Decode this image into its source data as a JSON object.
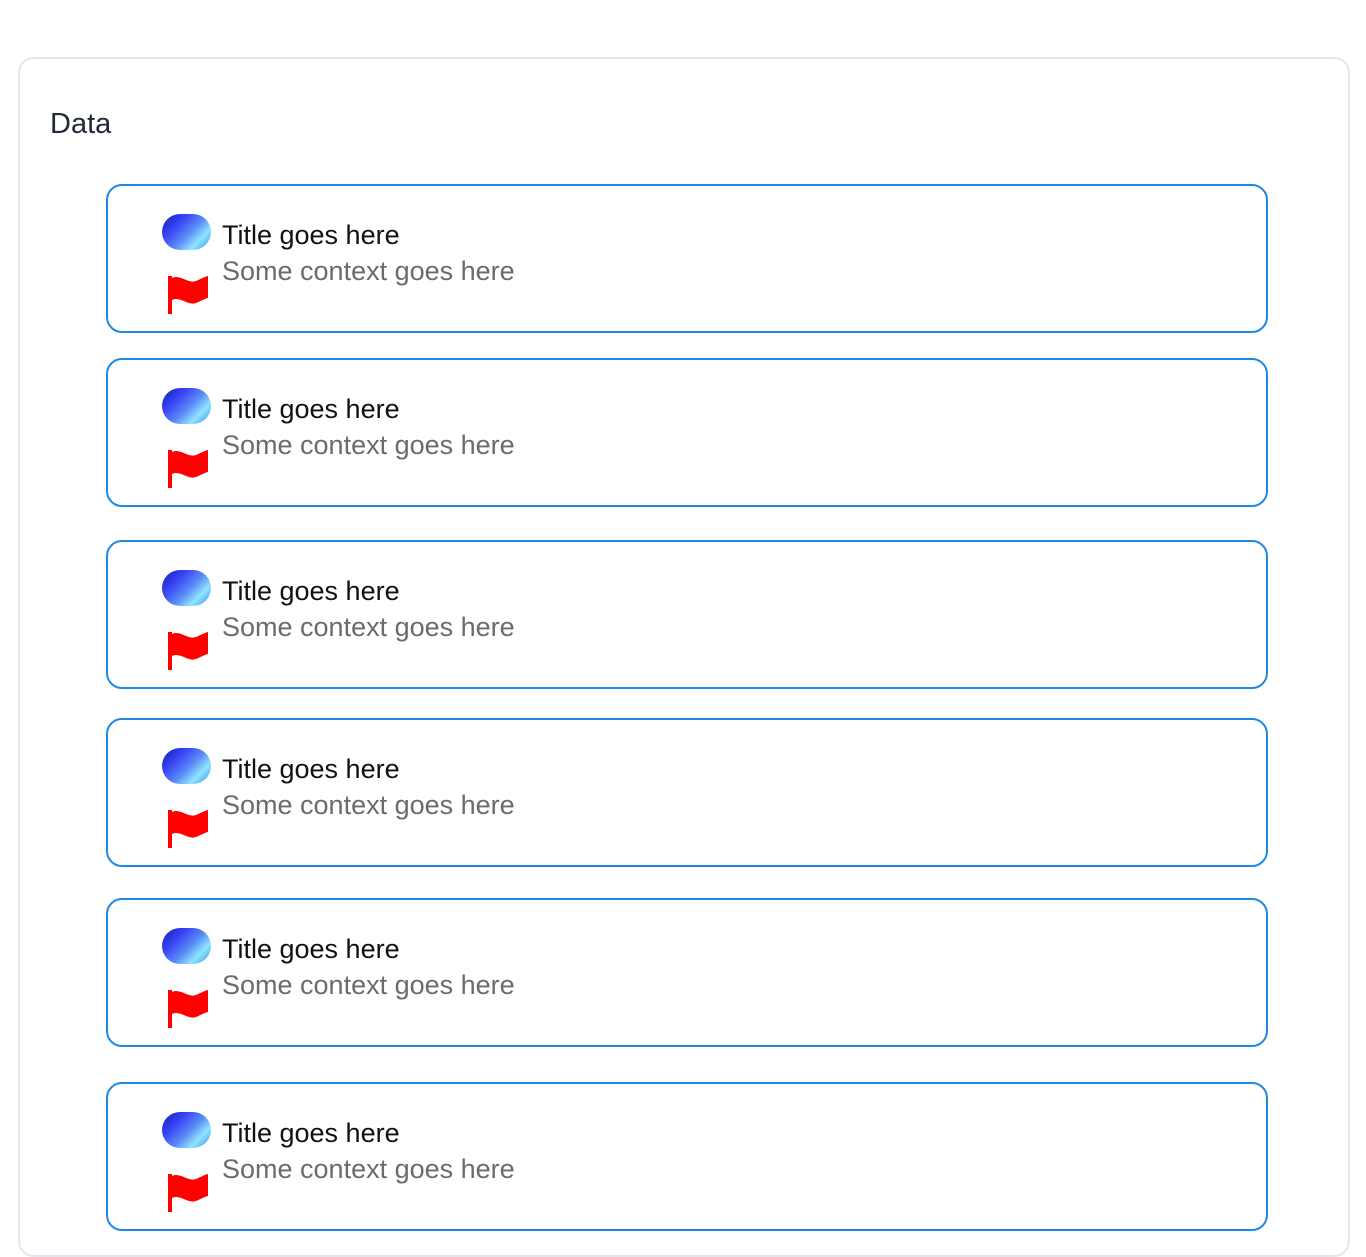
{
  "panel": {
    "title": "Data"
  },
  "items": [
    {
      "title": "Title goes here",
      "context": "Some context goes here",
      "avatar_icon": "gradient-pill-icon",
      "flag_icon": "red-flag-icon"
    },
    {
      "title": "Title goes here",
      "context": "Some context goes here",
      "avatar_icon": "gradient-pill-icon",
      "flag_icon": "red-flag-icon"
    },
    {
      "title": "Title goes here",
      "context": "Some context goes here",
      "avatar_icon": "gradient-pill-icon",
      "flag_icon": "red-flag-icon"
    },
    {
      "title": "Title goes here",
      "context": "Some context goes here",
      "avatar_icon": "gradient-pill-icon",
      "flag_icon": "red-flag-icon"
    },
    {
      "title": "Title goes here",
      "context": "Some context goes here",
      "avatar_icon": "gradient-pill-icon",
      "flag_icon": "red-flag-icon"
    },
    {
      "title": "Title goes here",
      "context": "Some context goes here",
      "avatar_icon": "gradient-pill-icon",
      "flag_icon": "red-flag-icon"
    }
  ],
  "colors": {
    "card_border": "#1e88e5",
    "flag": "#ff0000",
    "panel_border": "#e5e7eb"
  }
}
